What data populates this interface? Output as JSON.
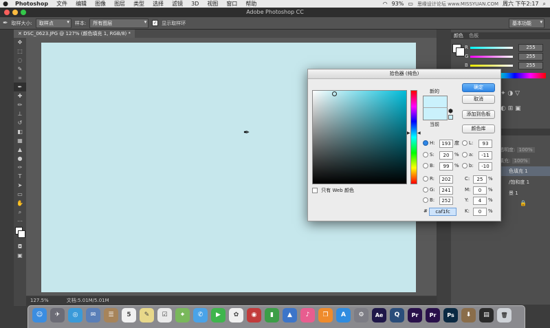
{
  "menubar": {
    "app": "Photoshop",
    "items": [
      "文件",
      "编辑",
      "图像",
      "图层",
      "类型",
      "选择",
      "滤镜",
      "3D",
      "视图",
      "窗口",
      "帮助"
    ],
    "battery": "93%",
    "datetime": "周六 下午2:17",
    "watermark": "思缘设计论坛 www.MISSYUAN.COM"
  },
  "window": {
    "title": "Adobe Photoshop CC"
  },
  "options_bar": {
    "sample_size_label": "取样大小:",
    "sample_size_value": "取样点",
    "sample_label": "样本:",
    "sample_value": "所有图层",
    "show_ring_label": "显示取样环",
    "workspace_value": "基本功能"
  },
  "document": {
    "tab_label": "DSC_0623.JPG @ 127% (颜色填充 1, RGB/8) *",
    "zoom": "127.5%",
    "doc_info": "文档:5.01M/5.01M",
    "canvas_color": "#c6e7ec"
  },
  "panels": {
    "color_tabs": [
      "颜色",
      "色板"
    ],
    "r_label": "R",
    "r_value": "255",
    "g_label": "G",
    "g_value": "255",
    "b_label": "B",
    "b_value": "255",
    "layers_partial": {
      "opacity_label": "透明度:",
      "opacity_value": "100%",
      "fill_label": "填充:",
      "fill_value": "100%",
      "rows": [
        "色填充 1",
        "/饱和度 1",
        "景 1"
      ]
    }
  },
  "color_picker": {
    "title": "拾色器 (纯色)",
    "new_label": "新的",
    "current_label": "当前",
    "buttons": {
      "ok": "确定",
      "cancel": "取消",
      "add_swatch": "添加到色板",
      "libraries": "颜色库"
    },
    "hsb": [
      {
        "label": "H:",
        "value": "193",
        "unit": "度",
        "selected": true
      },
      {
        "label": "S:",
        "value": "20",
        "unit": "%",
        "selected": false
      },
      {
        "label": "B:",
        "value": "99",
        "unit": "%",
        "selected": false
      }
    ],
    "rgb": [
      {
        "label": "R:",
        "value": "202"
      },
      {
        "label": "G:",
        "value": "241"
      },
      {
        "label": "B:",
        "value": "252"
      }
    ],
    "lab": [
      {
        "label": "L:",
        "value": "93"
      },
      {
        "label": "a:",
        "value": "-11"
      },
      {
        "label": "b:",
        "value": "-10"
      }
    ],
    "cmyk": [
      {
        "label": "C:",
        "value": "25",
        "unit": "%"
      },
      {
        "label": "M:",
        "value": "0",
        "unit": "%"
      },
      {
        "label": "Y:",
        "value": "4",
        "unit": "%"
      },
      {
        "label": "K:",
        "value": "0",
        "unit": "%"
      }
    ],
    "web_only_label": "只有 Web 颜色",
    "hex_label": "#",
    "hex_value": "caf1fc",
    "color": "#caf1fc"
  },
  "dock": {
    "icons": [
      {
        "name": "finder-icon",
        "glyph": "☺",
        "color": "#3b8de0"
      },
      {
        "name": "launchpad-icon",
        "glyph": "✈",
        "color": "#6c6c76"
      },
      {
        "name": "safari-icon",
        "glyph": "◎",
        "color": "#3a9ad9"
      },
      {
        "name": "mail-icon",
        "glyph": "✉",
        "color": "#5a7fb8"
      },
      {
        "name": "contacts-icon",
        "glyph": "☰",
        "color": "#a7845a"
      },
      {
        "name": "calendar-icon",
        "glyph": "5",
        "color": "#f1f1f1"
      },
      {
        "name": "notes-icon",
        "glyph": "✎",
        "color": "#e8d88a"
      },
      {
        "name": "reminders-icon",
        "glyph": "☑",
        "color": "#eaeaea"
      },
      {
        "name": "maps-icon",
        "glyph": "⌖",
        "color": "#79b85b"
      },
      {
        "name": "messages-icon",
        "glyph": "✆",
        "color": "#4aa3e8"
      },
      {
        "name": "facetime-icon",
        "glyph": "▶",
        "color": "#3fb54d"
      },
      {
        "name": "photos-icon",
        "glyph": "✿",
        "color": "#f0f0f0"
      },
      {
        "name": "photo-booth-icon",
        "glyph": "◉",
        "color": "#c23b3b"
      },
      {
        "name": "numbers-icon",
        "glyph": "▮",
        "color": "#3c9e47"
      },
      {
        "name": "keynote-icon",
        "glyph": "▲",
        "color": "#3d75c9"
      },
      {
        "name": "itunes-icon",
        "glyph": "♪",
        "color": "#e85d8f"
      },
      {
        "name": "ibooks-icon",
        "glyph": "❐",
        "color": "#ef8b2c"
      },
      {
        "name": "app-store-icon",
        "glyph": "A",
        "color": "#2f8ce0"
      },
      {
        "name": "system-preferences-icon",
        "glyph": "⚙",
        "color": "#7d7d85"
      },
      {
        "name": "after-effects-icon",
        "glyph": "Ae",
        "color": "#1f1749"
      },
      {
        "name": "quicktime-icon",
        "glyph": "Q",
        "color": "#2a4d7a"
      },
      {
        "name": "premiere-icon",
        "glyph": "Pr",
        "color": "#29104a"
      },
      {
        "name": "premiere-alt-icon",
        "glyph": "Pr",
        "color": "#29104a"
      },
      {
        "name": "photoshop-icon",
        "glyph": "Ps",
        "color": "#0b2a43"
      },
      {
        "name": "downloads-icon",
        "glyph": "⬇",
        "color": "#8a6d4a"
      },
      {
        "name": "screen-thumbnail-icon",
        "glyph": "▤",
        "color": "#2b2b2b"
      },
      {
        "name": "trash-icon",
        "glyph": "🗑",
        "color": "#cfd3d8"
      }
    ]
  }
}
